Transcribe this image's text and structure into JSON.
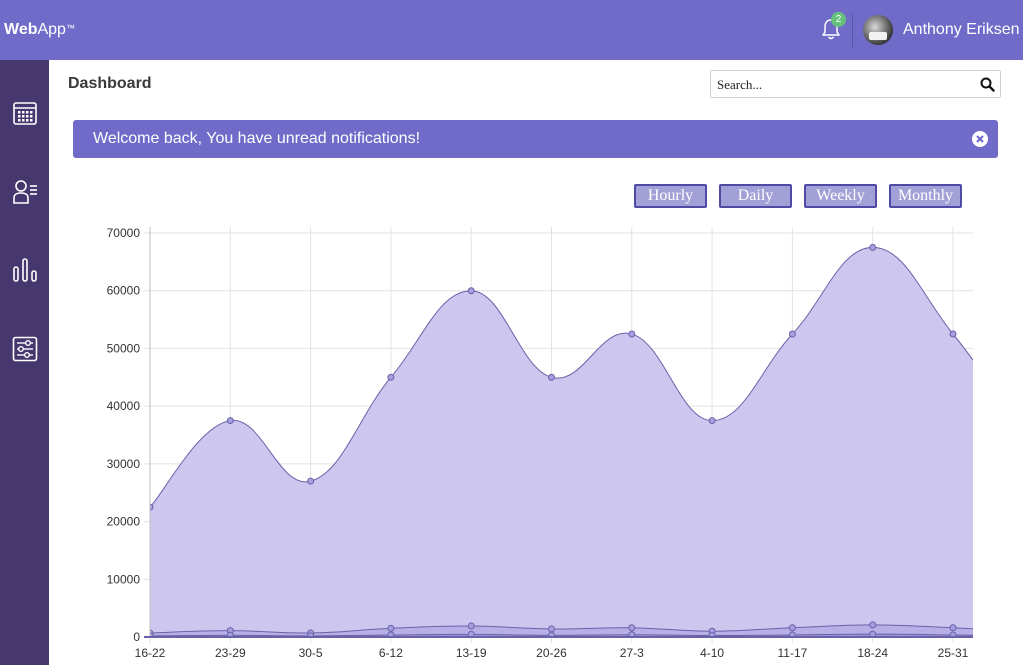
{
  "header": {
    "logo_bold": "Web",
    "logo_rest": "App",
    "logo_tm": "™",
    "notification_count": "2",
    "user_name": "Anthony Eriksen",
    "accent_color": "#706bc9"
  },
  "sidebar": {
    "items": [
      {
        "icon": "calendar-icon"
      },
      {
        "icon": "user-list-icon"
      },
      {
        "icon": "bar-chart-icon"
      },
      {
        "icon": "sliders-icon"
      }
    ]
  },
  "main": {
    "title": "Dashboard",
    "search": {
      "placeholder": "Search...",
      "value": ""
    },
    "alert": {
      "text": "Welcome back, You have unread notifications!"
    },
    "range_buttons": [
      "Hourly",
      "Daily",
      "Weekly",
      "Monthly"
    ]
  },
  "chart_data": {
    "type": "area",
    "x": [
      "16-22",
      "23-29",
      "30-5",
      "6-12",
      "13-19",
      "20-26",
      "27-3",
      "4-10",
      "11-17",
      "18-24",
      "25-31"
    ],
    "ylim": [
      0,
      70000
    ],
    "yticks": [
      0,
      10000,
      20000,
      30000,
      40000,
      50000,
      60000,
      70000
    ],
    "grid": true,
    "series": [
      {
        "values": [
          22500,
          37500,
          27000,
          45000,
          60000,
          45000,
          52500,
          37500,
          52500,
          67500,
          52500
        ],
        "color": "#cdc6ef"
      },
      {
        "values": [
          700,
          1100,
          700,
          1500,
          1900,
          1400,
          1600,
          1000,
          1600,
          2100,
          1600
        ],
        "color": "#b3aae4"
      },
      {
        "values": [
          200,
          300,
          200,
          350,
          450,
          300,
          400,
          250,
          350,
          500,
          350
        ],
        "color": "#9890d8"
      }
    ]
  }
}
